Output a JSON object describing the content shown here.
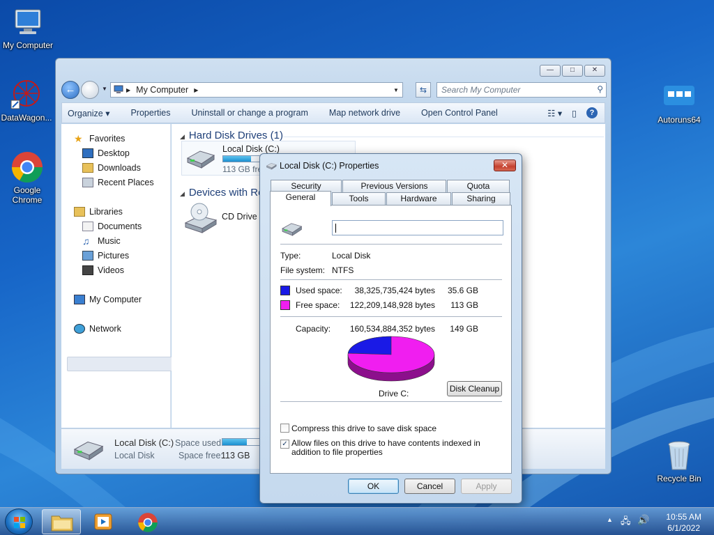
{
  "desktop": {
    "icons": [
      {
        "label": "My Computer",
        "icon": "computer-icon"
      },
      {
        "label": "DataWagon...",
        "icon": "datawagon-icon"
      },
      {
        "label": "Google Chrome",
        "icon": "chrome-icon"
      },
      {
        "label": "Autoruns64",
        "icon": "autoruns-icon"
      },
      {
        "label": "Recycle Bin",
        "icon": "recycle-bin-icon"
      }
    ]
  },
  "explorer": {
    "address": "My Computer",
    "search_placeholder": "Search My Computer",
    "window_buttons": {
      "minimize": "—",
      "maximize": "□",
      "close": "✕"
    },
    "commands": [
      "Organize ▾",
      "Properties",
      "Uninstall or change a program",
      "Map network drive",
      "Open Control Panel"
    ],
    "nav": {
      "favorites": "Favorites",
      "desktop": "Desktop",
      "downloads": "Downloads",
      "recent": "Recent Places",
      "libraries": "Libraries",
      "documents": "Documents",
      "music": "Music",
      "pictures": "Pictures",
      "videos": "Videos",
      "mycomputer": "My Computer",
      "network": "Network"
    },
    "groups": {
      "hdd": "Hard Disk Drives (1)",
      "devices": "Devices with Re"
    },
    "drive": {
      "name": "Local Disk (C:)",
      "free": "113 GB free",
      "used_fraction": 0.22
    },
    "cd": {
      "name": "CD Drive ("
    },
    "status": {
      "name": "Local Disk (C:)",
      "type": "Local Disk",
      "used_label": "Space used:",
      "free_label": "Space free:",
      "free_value": "113 GB"
    }
  },
  "dialog": {
    "title": "Local Disk (C:) Properties",
    "close": "✕",
    "tabs_top": [
      "Security",
      "Previous Versions",
      "Quota"
    ],
    "tabs_bottom": [
      "General",
      "Tools",
      "Hardware",
      "Sharing"
    ],
    "type_label": "Type:",
    "type_value": "Local Disk",
    "fs_label": "File system:",
    "fs_value": "NTFS",
    "used_label": "Used space:",
    "used_bytes": "38,325,735,424 bytes",
    "used_gb": "35.6 GB",
    "free_label": "Free space:",
    "free_bytes": "122,209,148,928 bytes",
    "free_gb": "113 GB",
    "capacity_label": "Capacity:",
    "capacity_bytes": "160,534,884,352 bytes",
    "capacity_gb": "149 GB",
    "drive_label": "Drive C:",
    "disk_cleanup": "Disk Cleanup",
    "compress_label": "Compress this drive to save disk space",
    "compress_checked": false,
    "index_label": "Allow files on this drive to have contents indexed in addition to file properties",
    "index_checked": true,
    "ok": "OK",
    "cancel": "Cancel",
    "apply": "Apply",
    "colors": {
      "used": "#1a1ae6",
      "free": "#f01ef0"
    },
    "chart_values": {
      "used_gb": 35.6,
      "free_gb": 113.8
    }
  },
  "taskbar": {
    "time": "10:55 AM",
    "date": "6/1/2022"
  }
}
